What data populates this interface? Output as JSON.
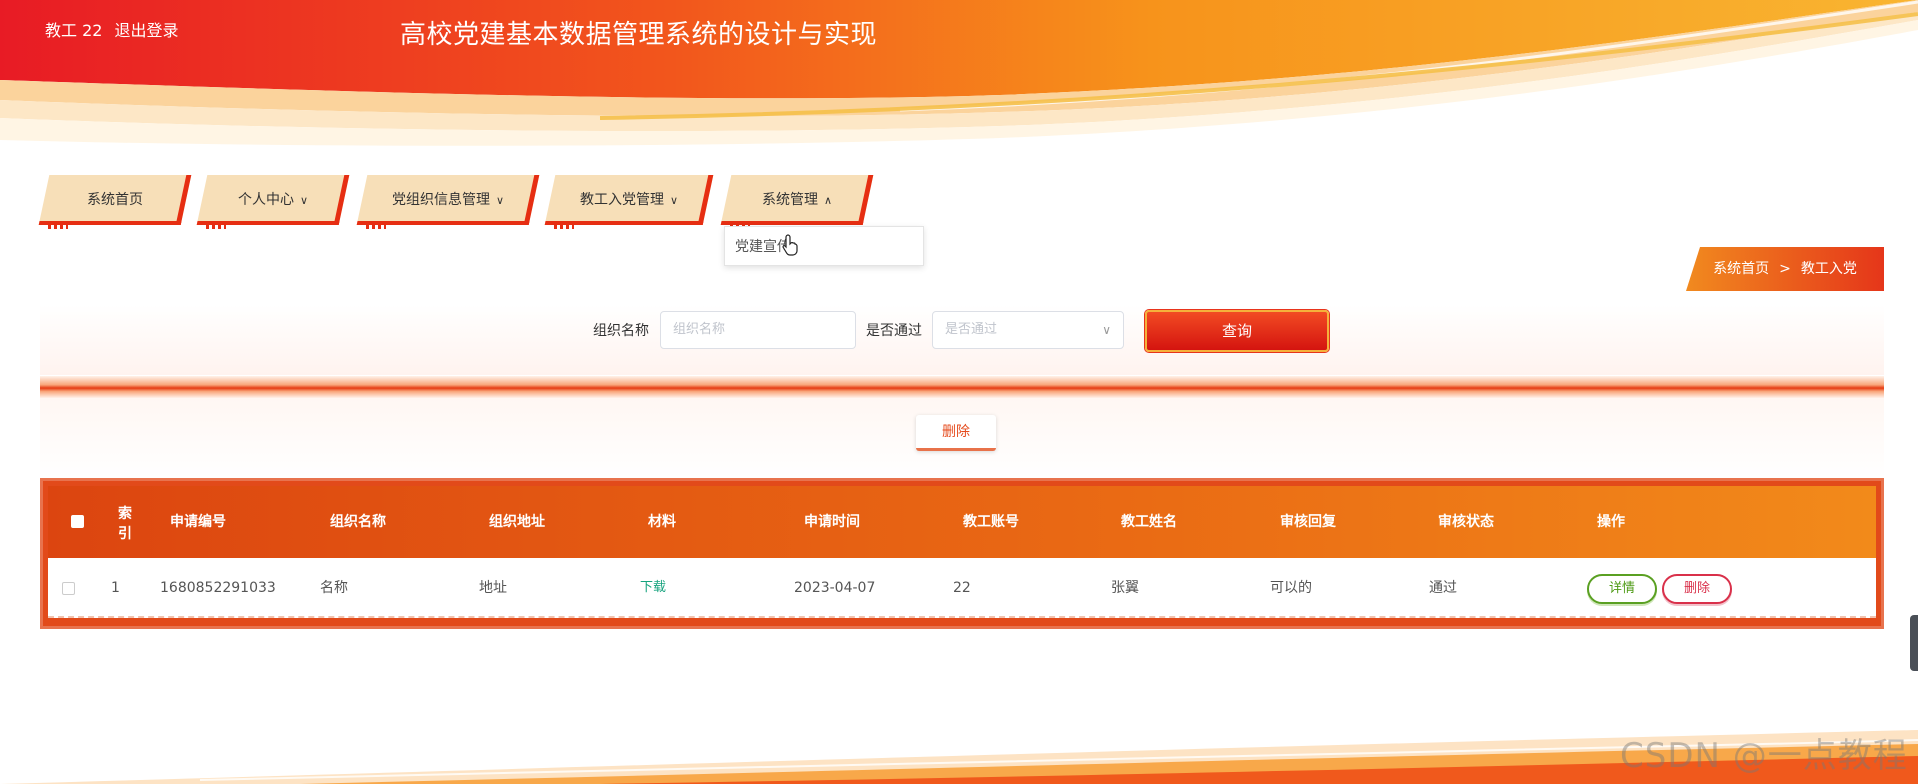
{
  "header": {
    "user": "教工 22",
    "logout_label": "退出登录",
    "title": "高校党建基本数据管理系统的设计与实现"
  },
  "nav": {
    "tabs": [
      {
        "label": "系统首页",
        "has_dropdown": false
      },
      {
        "label": "个人中心",
        "has_dropdown": true
      },
      {
        "label": "党组织信息管理",
        "has_dropdown": true
      },
      {
        "label": "教工入党管理",
        "has_dropdown": true
      },
      {
        "label": "系统管理",
        "has_dropdown": true,
        "expanded": true
      }
    ],
    "dropdown_items": [
      "党建宣传"
    ]
  },
  "breadcrumb": {
    "home": "系统首页",
    "separator": ">",
    "current": "教工入党"
  },
  "search": {
    "org_name_label": "组织名称",
    "org_name_placeholder": "组织名称",
    "passed_label": "是否通过",
    "passed_placeholder": "是否通过",
    "query_label": "查询"
  },
  "actions": {
    "delete_label": "删除"
  },
  "table": {
    "columns": [
      "索引",
      "申请编号",
      "组织名称",
      "组织地址",
      "材料",
      "申请时间",
      "教工账号",
      "教工姓名",
      "审核回复",
      "审核状态",
      "操作"
    ],
    "rows": [
      {
        "index": "1",
        "application_no": "1680852291033",
        "org_name": "名称",
        "org_address": "地址",
        "material": "下载",
        "apply_time": "2023-04-07",
        "staff_account": "22",
        "staff_name": "张翼",
        "review_reply": "可以的",
        "review_status": "通过",
        "detail_label": "详情",
        "delete_label": "删除"
      }
    ]
  },
  "watermark": "CSDN @一点教程",
  "colors": {
    "primary_red": "#e62e12",
    "primary_orange": "#f28a1a",
    "nav_bg": "#f7dfb8",
    "detail_green": "#5aa022",
    "delete_red": "#d9304a"
  }
}
